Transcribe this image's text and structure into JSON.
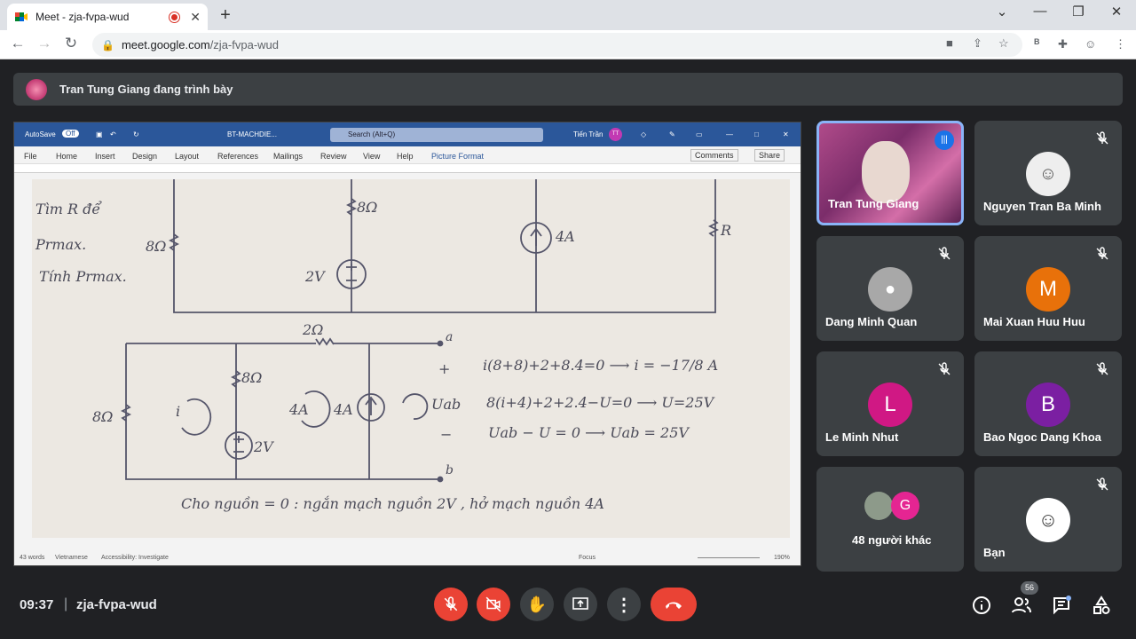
{
  "browser": {
    "tab_title": "Meet - zja-fvpa-wud",
    "url_host": "meet.google.com",
    "url_path": "/zja-fvpa-wud",
    "profile_initial": "B"
  },
  "banner": {
    "text": "Tran Tung Giang đang trình bày"
  },
  "word": {
    "autosave": "AutoSave",
    "autosave_state": "Off",
    "doc_name": "BT-MACHDIE...",
    "search_placeholder": "Search (Alt+Q)",
    "user": "Tiến Trần",
    "user_initials": "TT",
    "menu": [
      "File",
      "Home",
      "Insert",
      "Design",
      "Layout",
      "References",
      "Mailings",
      "Review",
      "View",
      "Help",
      "Picture Format"
    ],
    "comments": "Comments",
    "share": "Share",
    "status_words": "43 words",
    "status_lang": "Vietnamese",
    "status_access": "Accessibility: Investigate",
    "status_focus": "Focus",
    "zoom": "190%"
  },
  "notes": {
    "line1": "Tìm R để",
    "line2": "Prmax.",
    "line3": "Tính Prmax.",
    "eq1": "i(8+8)+2+8.4=0 ⟶ i = −17/8 A",
    "eq2": "8(i+4)+2+2.4−U=0 ⟶ U=25V",
    "eq3": "Uab − U = 0 ⟶ Uab = 25V",
    "bottom": "Cho nguồn = 0 : ngắn mạch nguồn 2V , hở mạch nguồn 4A",
    "r8": "8Ω",
    "r2": "2Ω",
    "src2v": "2V",
    "src4a": "4A",
    "r_label": "R",
    "node_a": "a",
    "node_b": "b",
    "uab": "Uab",
    "plus": "+",
    "minus": "−",
    "loop_i": "i"
  },
  "participants": [
    {
      "name": "Tran Tung Giang",
      "initial": "",
      "color": "",
      "speaking": true
    },
    {
      "name": "Nguyen Tran Ba Minh",
      "initial": "",
      "color": "#eeeeee",
      "muted": true
    },
    {
      "name": "Dang Minh Quan",
      "initial": "",
      "color": "#a8a8a8",
      "muted": true
    },
    {
      "name": "Mai Xuan Huu Huu",
      "initial": "M",
      "color": "#e8710a",
      "muted": true
    },
    {
      "name": "Le Minh Nhut",
      "initial": "L",
      "color": "#d01884",
      "muted": true
    },
    {
      "name": "Bao Ngoc Dang Khoa",
      "initial": "B",
      "color": "#7b1fa2",
      "muted": true
    },
    {
      "name": "48 người khác",
      "initial": "G",
      "color": "#e52592"
    },
    {
      "name": "Bạn",
      "initial": "",
      "color": "#ffffff",
      "muted": true
    }
  ],
  "bottom": {
    "time": "09:37",
    "separator": "|",
    "meeting_code": "zja-fvpa-wud",
    "people_count": "56"
  }
}
